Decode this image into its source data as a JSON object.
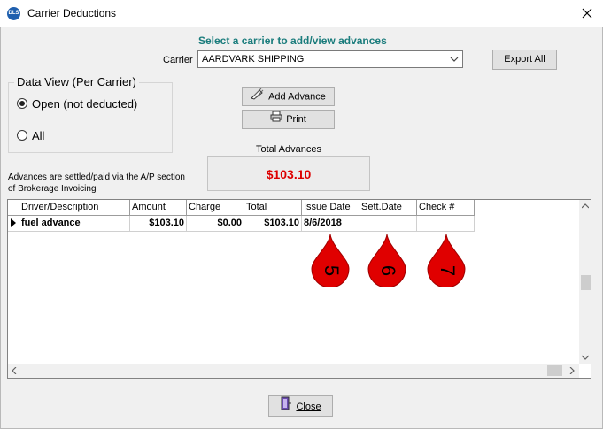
{
  "window": {
    "title": "Carrier Deductions",
    "app_icon_label": "DLS"
  },
  "heading": "Select a carrier to add/view advances",
  "carrier": {
    "label": "Carrier",
    "value": "AARDVARK SHIPPING"
  },
  "export_label": "Export All",
  "data_view": {
    "legend": "Data View (Per Carrier)",
    "options": [
      {
        "label": "Open (not deducted)",
        "selected": true
      },
      {
        "label": "All",
        "selected": false
      }
    ]
  },
  "add_advance_label": "Add Advance",
  "print_label": "Print",
  "total": {
    "label": "Total Advances",
    "value": "$103.10"
  },
  "note": "Advances are settled/paid via the A/P section of Brokerage Invoicing",
  "grid": {
    "columns": [
      "Driver/Description",
      "Amount",
      "Charge",
      "Total",
      "Issue Date",
      "Sett.Date",
      "Check #"
    ],
    "rows": [
      {
        "driver": "fuel advance",
        "amount": "$103.10",
        "charge": "$0.00",
        "total": "$103.10",
        "issue_date": "8/6/2018",
        "sett_date": "",
        "check": ""
      }
    ]
  },
  "markers": [
    "5",
    "6",
    "7"
  ],
  "close_label": "Close",
  "colors": {
    "heading": "#1a7c7c",
    "total": "#dd0000",
    "marker": "#e00000"
  }
}
